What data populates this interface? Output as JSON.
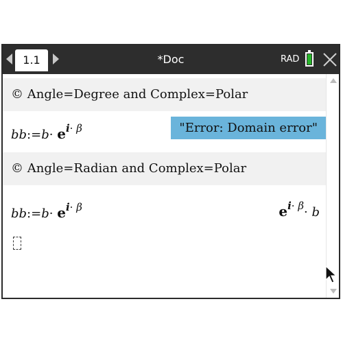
{
  "header": {
    "tab_label": "1.1",
    "doc_title": "*Doc",
    "angle_mode": "RAD",
    "battery_color": "#27b52a"
  },
  "rows": [
    {
      "kind": "comment",
      "text": "© Angle=Degree and Complex=Polar"
    },
    {
      "kind": "expr",
      "lhs": "bb",
      "assign": ":=",
      "var_b": "b",
      "dot": "·",
      "base": "e",
      "exp_i": "i",
      "exp_dot": "·",
      "exp_beta": "β",
      "result": "\"Error: Domain error\"",
      "result_kind": "error"
    },
    {
      "kind": "comment",
      "text": "© Angle=Radian and Complex=Polar"
    },
    {
      "kind": "expr",
      "lhs": "bb",
      "assign": ":=",
      "var_b": "b",
      "dot": "·",
      "base": "e",
      "exp_i": "i",
      "exp_dot": "·",
      "exp_beta": "β",
      "result_base": "e",
      "result_exp_i": "i",
      "result_exp_dot": "·",
      "result_exp_beta": "β",
      "result_dot": "·",
      "result_b": "b",
      "result_kind": "plain"
    }
  ],
  "colors": {
    "topbar": "#2d2d2d",
    "comment_bg": "#f1f1f1",
    "error_highlight": "#6ab4db"
  },
  "icons": [
    "arrow-left-icon",
    "arrow-right-icon",
    "battery-icon",
    "close-icon",
    "mouse-pointer-icon",
    "scroll-up-icon",
    "scroll-down-icon"
  ]
}
